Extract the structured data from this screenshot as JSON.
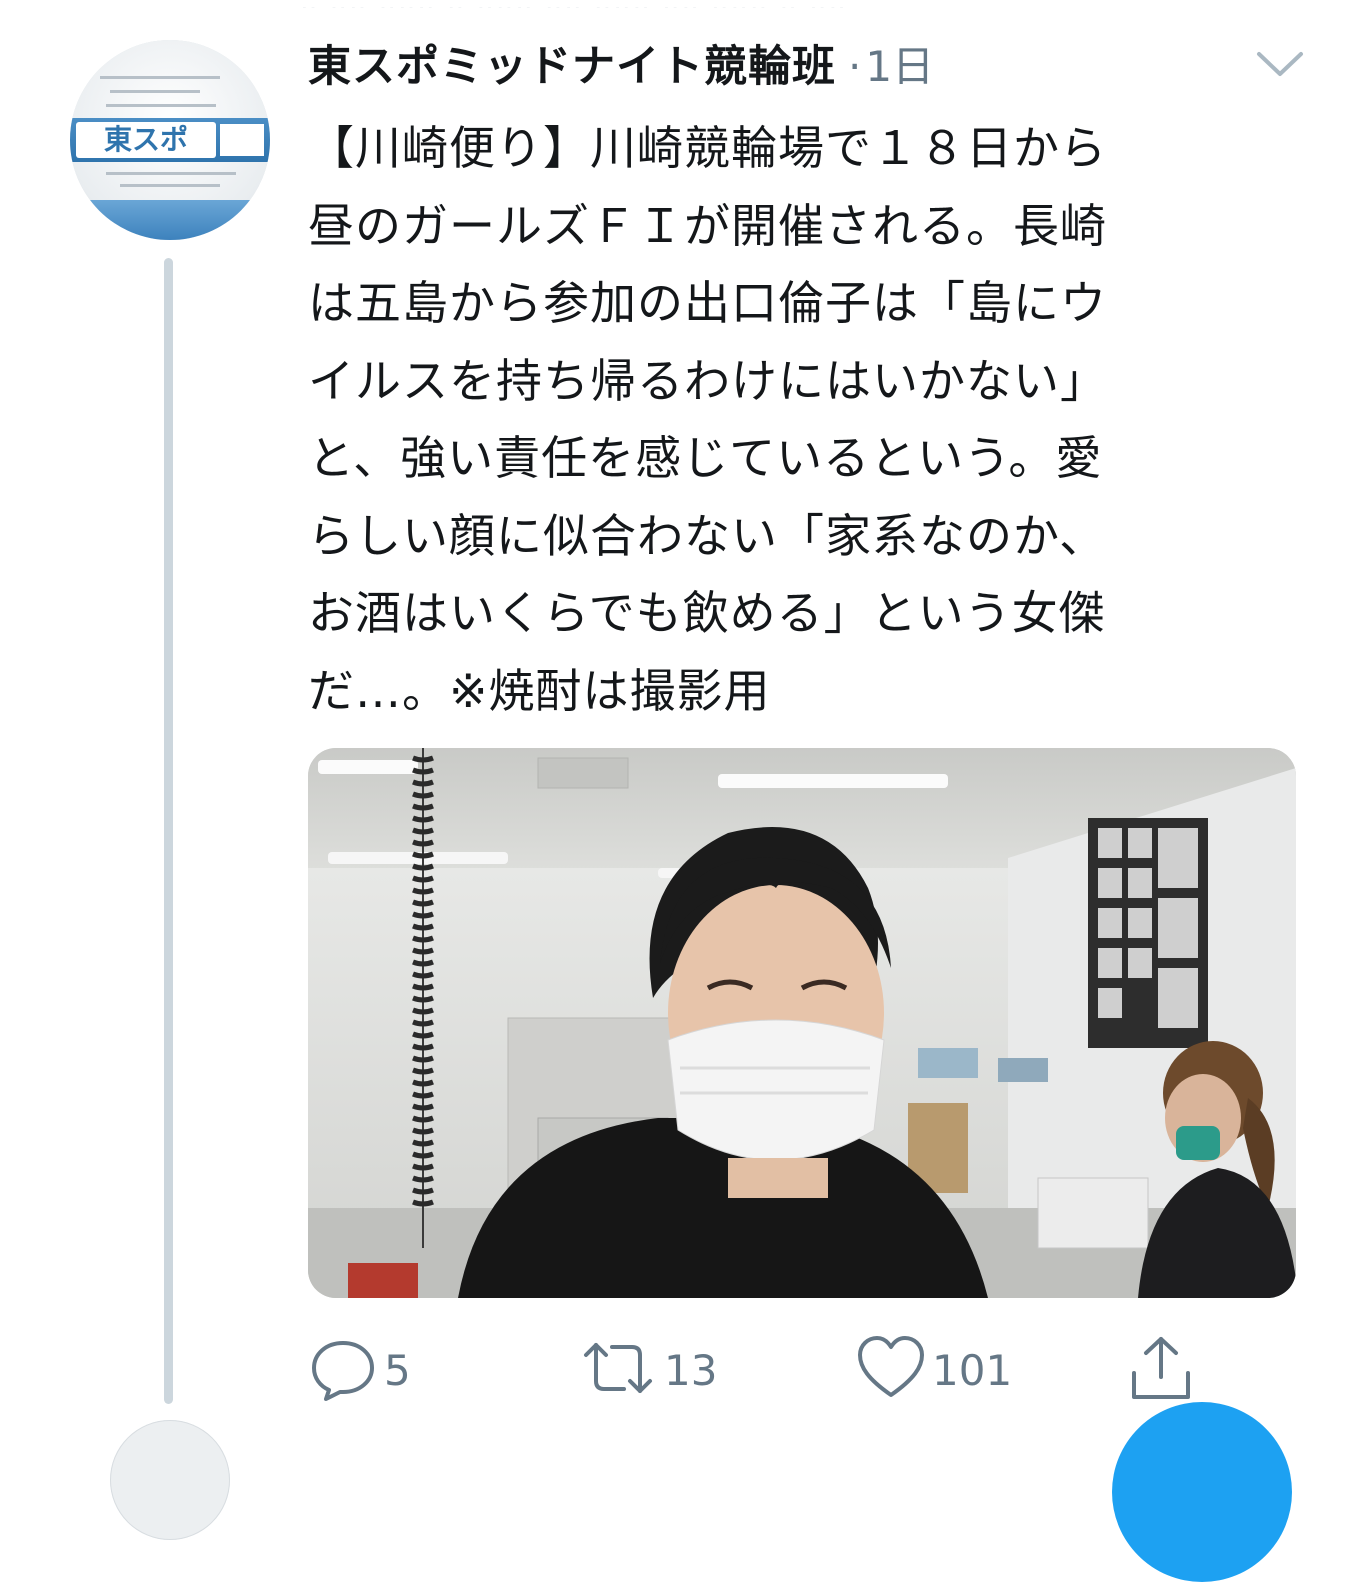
{
  "tweet": {
    "author_name": "東スポミッドナイト競輪班",
    "separator": "·",
    "time": "1日",
    "text": "【川崎便り】川崎競輪場で１８日から\n昼のガールズＦＩが開催される。長崎\nは五島から参加の出口倫子は「島にウ\nイルスを持ち帰るわけにはいかない」\nと、強い責任を感じているという。愛\nらしい顔に似合わない「家系なのか、\nお酒はいくらでも飲める」という女傑\nだ…。※焼酎は撮影用",
    "avatar_logo_text": "東スポ",
    "media_alt": "photo"
  },
  "actions": {
    "reply_count": "5",
    "retweet_count": "13",
    "like_count": "101"
  },
  "icons": {
    "reply": "reply-icon",
    "retweet": "retweet-icon",
    "like": "heart-icon",
    "share": "share-icon",
    "more": "chevron-down-icon"
  },
  "colors": {
    "text": "#14171a",
    "muted": "#657786",
    "thread_line": "#ccd6dd",
    "accent": "#1da1f2"
  }
}
